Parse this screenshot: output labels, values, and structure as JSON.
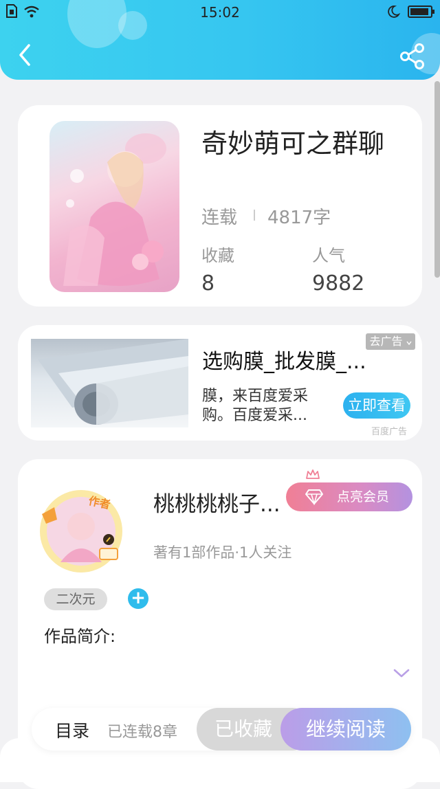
{
  "status_bar": {
    "time": "15:02"
  },
  "book": {
    "title": "奇妙萌可之群聊",
    "status": "连载",
    "word_count": "4817字",
    "stats": [
      {
        "label": "收藏",
        "value": "8"
      },
      {
        "label": "人气",
        "value": "9882"
      }
    ]
  },
  "ad": {
    "title": "选购膜_批发膜_...",
    "description": "膜，来百度爱采购。百度爱采...",
    "close_label": "去广告",
    "button_label": "立即查看",
    "source": "百度广告"
  },
  "author": {
    "name": "桃桃桃桃子...",
    "vip_label": "点亮会员",
    "badge_text": "作者",
    "meta": "著有1部作品·1人关注",
    "tag": "二次元",
    "add_tag": "+",
    "intro_label": "作品简介:"
  },
  "bottom_bar": {
    "toc_label": "目录",
    "chapters_label": "已连载8章",
    "collected_label": "已收藏",
    "continue_label": "继续阅读"
  },
  "colors": {
    "header_accent": "#36c6f0",
    "ad_button": "#2cb1ef",
    "vip_gradient_start": "#f07f95",
    "vip_gradient_end": "#b392e0",
    "continue_gradient_start": "#bb9de8",
    "continue_gradient_end": "#8ec0f0"
  },
  "icons": [
    "back-arrow-icon",
    "share-icon",
    "sim-icon",
    "wifi-icon",
    "moon-icon",
    "battery-icon",
    "diamond-icon",
    "crown-icon",
    "chevron-down-icon",
    "edit-icon"
  ]
}
